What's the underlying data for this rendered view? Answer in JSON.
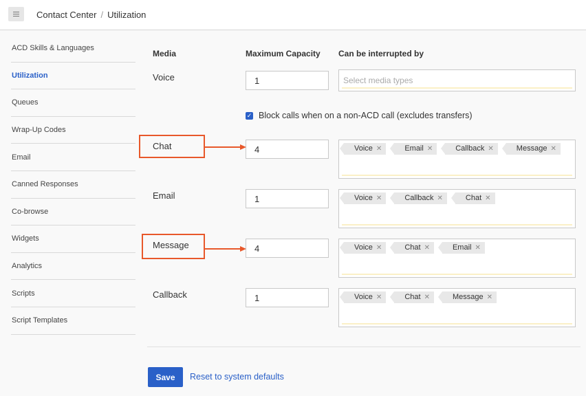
{
  "breadcrumb": {
    "root": "Contact Center",
    "separator": "/",
    "current": "Utilization"
  },
  "sidebar": {
    "items": [
      {
        "label": "ACD Skills & Languages"
      },
      {
        "label": "Utilization",
        "active": true
      },
      {
        "label": "Queues"
      },
      {
        "label": "Wrap-Up Codes"
      },
      {
        "label": "Email"
      },
      {
        "label": "Canned Responses"
      },
      {
        "label": "Co-browse"
      },
      {
        "label": "Widgets"
      },
      {
        "label": "Analytics"
      },
      {
        "label": "Scripts"
      },
      {
        "label": "Script Templates"
      }
    ]
  },
  "table": {
    "headers": {
      "media": "Media",
      "capacity": "Maximum Capacity",
      "interrupt": "Can be interrupted by"
    },
    "rows": [
      {
        "media": "Voice",
        "capacity": "1",
        "interrupt_placeholder": "Select media types",
        "tags": []
      },
      {
        "media": "Chat",
        "capacity": "4",
        "tags": [
          "Voice",
          "Email",
          "Callback",
          "Message"
        ]
      },
      {
        "media": "Email",
        "capacity": "1",
        "tags": [
          "Voice",
          "Callback",
          "Chat"
        ]
      },
      {
        "media": "Message",
        "capacity": "4",
        "tags": [
          "Voice",
          "Chat",
          "Email"
        ]
      },
      {
        "media": "Callback",
        "capacity": "1",
        "tags": [
          "Voice",
          "Chat",
          "Message"
        ]
      }
    ],
    "block_calls_label": "Block calls when on a non-ACD call (excludes transfers)",
    "block_calls_checked": true
  },
  "actions": {
    "save_label": "Save",
    "reset_label": "Reset to system defaults"
  },
  "colors": {
    "accent": "#2a60c8",
    "highlight": "#e8582a"
  },
  "icons": {
    "menu": "hamburger-icon",
    "remove_tag": "close-icon",
    "checkbox": "checkmark-icon"
  }
}
